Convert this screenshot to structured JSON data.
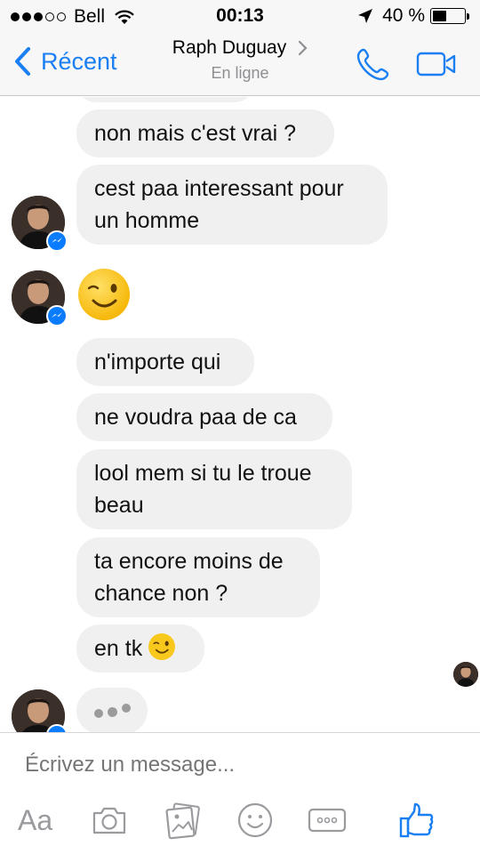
{
  "status_bar": {
    "carrier": "Bell",
    "time": "00:13",
    "battery_percent_text": "40 %",
    "battery_level": 0.4
  },
  "nav": {
    "back_label": "Récent",
    "contact_name": "Raph Duguay",
    "contact_status": "En ligne",
    "accent_color": "#1a7ff2"
  },
  "messages": [
    {
      "id": "m1",
      "sender": "contact",
      "text": "non mais c'est vrai ?"
    },
    {
      "id": "m2",
      "sender": "contact",
      "line1": "cest paa interessant pour",
      "line2": "un homme"
    },
    {
      "id": "m3",
      "sender": "contact",
      "emoji": "winking-face-icon"
    },
    {
      "id": "m4",
      "sender": "contact",
      "text": "n'importe qui"
    },
    {
      "id": "m5",
      "sender": "contact",
      "text": "ne voudra paa de ca"
    },
    {
      "id": "m6",
      "sender": "contact",
      "line1": "lool mem si tu le troue",
      "line2": "beau"
    },
    {
      "id": "m7",
      "sender": "contact",
      "line1": "ta encore moins de",
      "line2": "chance non ?"
    },
    {
      "id": "m8",
      "sender": "contact",
      "text": "en tk",
      "emoji": "winking-face-icon"
    }
  ],
  "typing_indicator": true,
  "composer": {
    "placeholder": "Écrivez un message...",
    "aa_label": "Aa",
    "icons": [
      "camera-icon",
      "photo-gallery-icon",
      "emoji-icon",
      "more-icon",
      "like-icon"
    ]
  },
  "colors": {
    "bubble": "#f1f0f0",
    "messenger_badge": "#0a7cff"
  }
}
